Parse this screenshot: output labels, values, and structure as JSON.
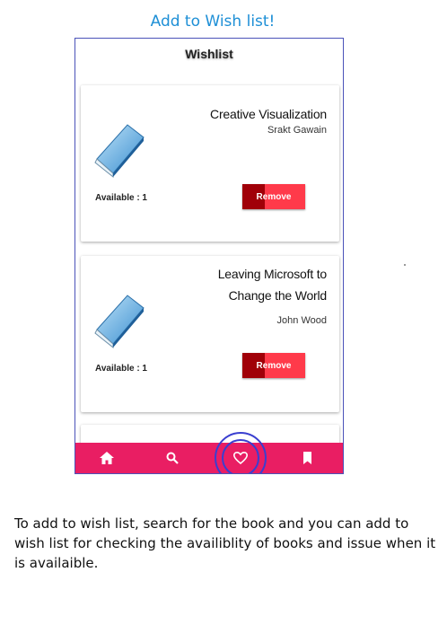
{
  "heading": "Add to Wish list!",
  "app": {
    "title": "Wishlist",
    "books": [
      {
        "title_line1": "Creative Visualization",
        "title_line2": "",
        "author": "Srakt Gawain",
        "available": "Available : 1",
        "remove_label": "Remove"
      },
      {
        "title_line1": "Leaving Microsoft to",
        "title_line2": "Change the World",
        "author": "John Wood",
        "available": "Available : 1",
        "remove_label": "Remove"
      }
    ],
    "nav": {
      "items": [
        "home-icon",
        "search-icon",
        "heart-icon",
        "bookmark-icon"
      ],
      "active": "heart-icon",
      "color": "#e91e63"
    },
    "highlight_color": "#3a3fd0",
    "remove_colors": [
      "#a00008",
      "#ff3a4a"
    ]
  },
  "instructions": "To add to wish list, search for the book and you can add to wish list for checking the availiblity of books and issue when it is availaible."
}
